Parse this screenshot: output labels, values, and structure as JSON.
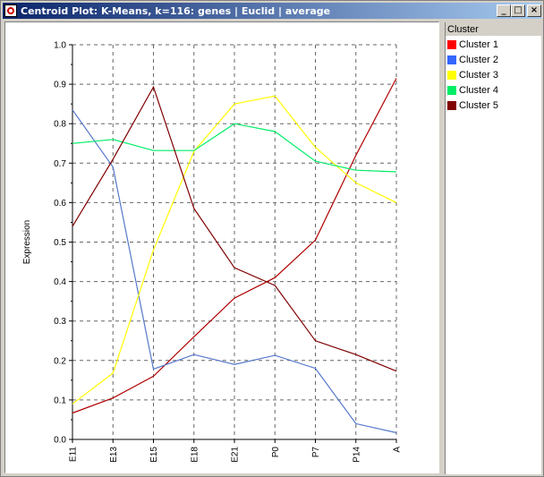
{
  "window": {
    "title": "Centroid Plot: K-Means, k=116: genes  | Euclid | average",
    "minimize_label": "_",
    "maximize_label": "□",
    "close_label": "×"
  },
  "legend": {
    "header": "Cluster",
    "items": [
      {
        "label": "Cluster 1",
        "color": "#ff0000"
      },
      {
        "label": "Cluster 2",
        "color": "#3366ff"
      },
      {
        "label": "Cluster 3",
        "color": "#ffff00"
      },
      {
        "label": "Cluster 4",
        "color": "#00ee66"
      },
      {
        "label": "Cluster 5",
        "color": "#800000"
      }
    ]
  },
  "chart_data": {
    "type": "line",
    "ylabel": "Expression",
    "ylim": [
      0.0,
      1.0
    ],
    "yticks": [
      "0.0",
      "0.1",
      "0.2",
      "0.3",
      "0.4",
      "0.5",
      "0.6",
      "0.7",
      "0.8",
      "0.9",
      "1.0"
    ],
    "categories": [
      "E11",
      "E13",
      "E15",
      "E18",
      "E21",
      "P0",
      "P7",
      "P14",
      "A"
    ],
    "grid": true,
    "series": [
      {
        "name": "Cluster 1",
        "color": "#b00000",
        "values": [
          0.067,
          0.105,
          0.16,
          0.26,
          0.358,
          0.41,
          0.505,
          0.72,
          0.915
        ]
      },
      {
        "name": "Cluster 2",
        "color": "#5577cc",
        "values": [
          0.835,
          0.69,
          0.178,
          0.215,
          0.19,
          0.213,
          0.18,
          0.04,
          0.017
        ]
      },
      {
        "name": "Cluster 3",
        "color": "#ffff00",
        "values": [
          0.09,
          0.168,
          0.48,
          0.73,
          0.85,
          0.87,
          0.74,
          0.65,
          0.6
        ]
      },
      {
        "name": "Cluster 4",
        "color": "#00ee66",
        "values": [
          0.75,
          0.76,
          0.732,
          0.732,
          0.8,
          0.78,
          0.705,
          0.682,
          0.678
        ]
      },
      {
        "name": "Cluster 5",
        "color": "#800000",
        "values": [
          0.54,
          0.71,
          0.893,
          0.585,
          0.435,
          0.39,
          0.25,
          0.215,
          0.173
        ]
      }
    ]
  }
}
